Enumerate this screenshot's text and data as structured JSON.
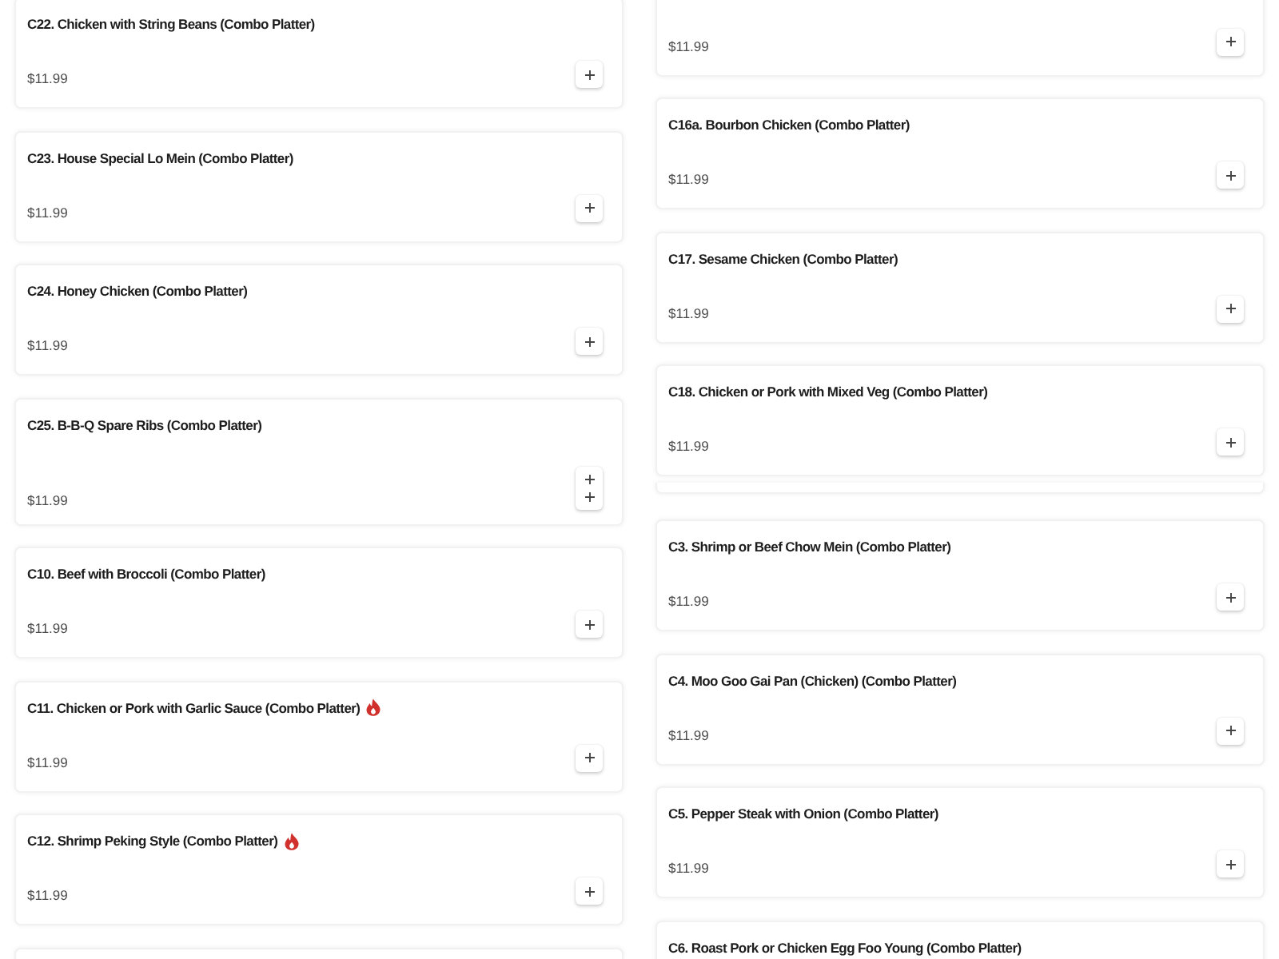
{
  "columns": [
    {
      "items": [
        {
          "kind": "full",
          "title": "C22. Chicken with String Beans (Combo Platter)",
          "spicy": false,
          "price": "$11.99"
        },
        {
          "kind": "full",
          "title": "C23. House Special Lo Mein (Combo Platter)",
          "spicy": false,
          "price": "$11.99"
        },
        {
          "kind": "full",
          "title": "C24. Honey Chicken (Combo Platter)",
          "spicy": false,
          "price": "$11.99"
        },
        {
          "kind": "doubled",
          "title": "C25. B-B-Q Spare Ribs (Combo Platter)",
          "spicy": false,
          "price": "$11.99"
        },
        {
          "kind": "full",
          "title": "C10. Beef with Broccoli (Combo Platter)",
          "spicy": false,
          "price": "$11.99"
        },
        {
          "kind": "full",
          "title": "C11. Chicken or Pork with Garlic Sauce (Combo Platter)",
          "spicy": true,
          "price": "$11.99"
        },
        {
          "kind": "full",
          "title": "C12. Shrimp Peking Style (Combo Platter)",
          "spicy": true,
          "price": "$11.99"
        },
        {
          "kind": "edge"
        }
      ]
    },
    {
      "items": [
        {
          "kind": "priced",
          "price": "$11.99"
        },
        {
          "kind": "full",
          "title": "C16a. Bourbon Chicken (Combo Platter)",
          "spicy": false,
          "price": "$11.99"
        },
        {
          "kind": "full",
          "title": "C17. Sesame Chicken (Combo Platter)",
          "spicy": false,
          "price": "$11.99"
        },
        {
          "kind": "full",
          "title": "C18. Chicken or Pork with Mixed Veg (Combo Platter)",
          "spicy": false,
          "price": "$11.99"
        },
        {
          "kind": "sliver"
        },
        {
          "kind": "full",
          "title": "C3. Shrimp or Beef Chow Mein (Combo Platter)",
          "spicy": false,
          "price": "$11.99"
        },
        {
          "kind": "full",
          "title": "C4. Moo Goo Gai Pan (Chicken) (Combo Platter)",
          "spicy": false,
          "price": "$11.99"
        },
        {
          "kind": "full",
          "title": "C5. Pepper Steak with Onion (Combo Platter)",
          "spicy": false,
          "price": "$11.99"
        },
        {
          "kind": "titled",
          "title": "C6. Roast Pork or Chicken Egg Foo Young (Combo Platter)",
          "spicy": false
        }
      ]
    }
  ]
}
